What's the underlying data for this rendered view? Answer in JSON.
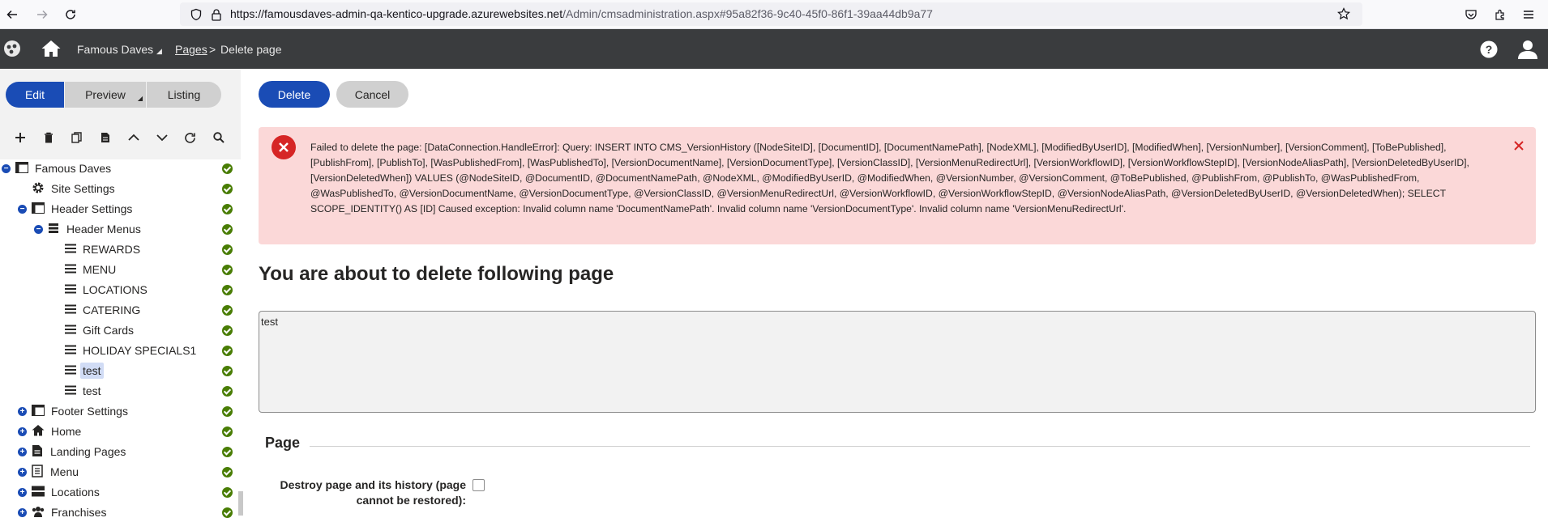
{
  "browser": {
    "url_domain": "https://famousdaves-admin-qa-kentico-upgrade.azurewebsites.net",
    "url_path": "/Admin/cmsadministration.aspx#95a82f36-9c40-45f0-86f1-39aa44db9a77"
  },
  "header": {
    "site_name": "Famous Daves",
    "breadcrumb_link": "Pages",
    "breadcrumb_separator": ">",
    "breadcrumb_current": "Delete page"
  },
  "modes": {
    "edit": "Edit",
    "preview": "Preview",
    "listing": "Listing"
  },
  "tree": {
    "root": "Famous Daves",
    "site_settings": "Site Settings",
    "header_settings": "Header Settings",
    "header_menus": "Header Menus",
    "items": [
      "REWARDS",
      "MENU",
      "LOCATIONS",
      "CATERING",
      "Gift Cards",
      "HOLIDAY SPECIALS1",
      "test",
      "test"
    ],
    "footer_settings": "Footer Settings",
    "home": "Home",
    "landing_pages": "Landing Pages",
    "menu": "Menu",
    "locations": "Locations",
    "franchises": "Franchises"
  },
  "actions": {
    "delete": "Delete",
    "cancel": "Cancel"
  },
  "error": {
    "message": "Failed to delete the page: [DataConnection.HandleError]: Query: INSERT INTO CMS_VersionHistory ([NodeSiteID], [DocumentID], [DocumentNamePath], [NodeXML], [ModifiedByUserID], [ModifiedWhen], [VersionNumber], [VersionComment], [ToBePublished], [PublishFrom], [PublishTo], [WasPublishedFrom], [WasPublishedTo], [VersionDocumentName], [VersionDocumentType], [VersionClassID], [VersionMenuRedirectUrl], [VersionWorkflowID], [VersionWorkflowStepID], [VersionNodeAliasPath], [VersionDeletedByUserID], [VersionDeletedWhen]) VALUES (@NodeSiteID, @DocumentID, @DocumentNamePath, @NodeXML, @ModifiedByUserID, @ModifiedWhen, @VersionNumber, @VersionComment, @ToBePublished, @PublishFrom, @PublishTo, @WasPublishedFrom, @WasPublishedTo, @VersionDocumentName, @VersionDocumentType, @VersionClassID, @VersionMenuRedirectUrl, @VersionWorkflowID, @VersionWorkflowStepID, @VersionNodeAliasPath, @VersionDeletedByUserID, @VersionDeletedWhen); SELECT SCOPE_IDENTITY() AS [ID] Caused exception: Invalid column name 'DocumentNamePath'. Invalid column name 'VersionDocumentType'. Invalid column name 'VersionMenuRedirectUrl'."
  },
  "content": {
    "heading": "You are about to delete following page",
    "page_list": "test",
    "section_title": "Page",
    "destroy_label": "Destroy page and its history (page cannot be restored):",
    "destroy_checked": false
  },
  "colors": {
    "primary": "#1a4cb5",
    "header_bg": "#3a3c3e",
    "error_bg": "#fbd8d8",
    "error_icon": "#d62525",
    "published": "#497d04"
  }
}
